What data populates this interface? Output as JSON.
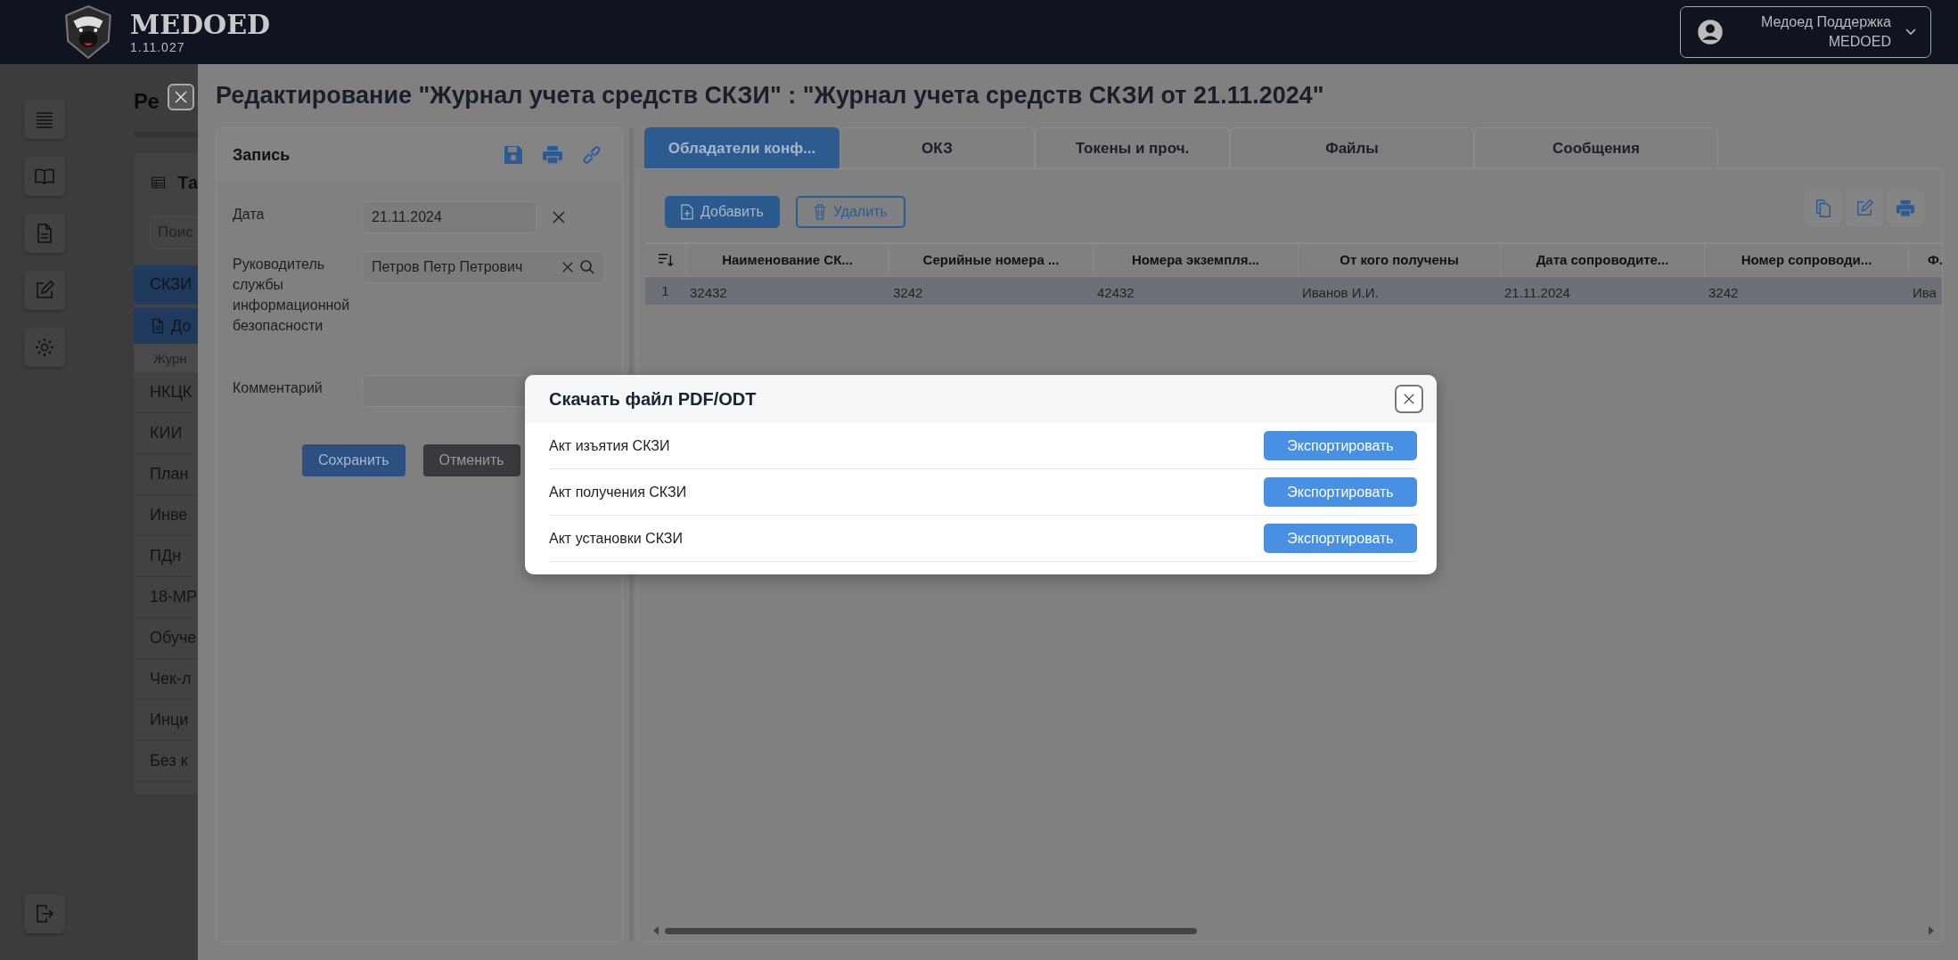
{
  "header": {
    "logo_text": "MEDOED",
    "version": "1.11.027",
    "user": {
      "name": "Медоед Поддержка",
      "org": "MEDOED"
    }
  },
  "background_page": {
    "title": "Ре",
    "card_title": "Та",
    "search": {
      "placeholder": "Поис"
    },
    "menu": [
      {
        "label": "СКЗИ",
        "selected": true,
        "children": [
          {
            "label": "До",
            "selected": true,
            "children": [
              {
                "label": "Журн",
                "selected": false
              }
            ]
          }
        ]
      },
      {
        "label": "НКЦК",
        "selected": false
      },
      {
        "label": "КИИ",
        "selected": false
      },
      {
        "label": "План",
        "selected": false
      },
      {
        "label": "Инве",
        "selected": false
      },
      {
        "label": "ПДн",
        "selected": false
      },
      {
        "label": "18-МР",
        "selected": false
      },
      {
        "label": "Обуче",
        "selected": false
      },
      {
        "label": "Чек-л",
        "selected": false
      },
      {
        "label": "Инци",
        "selected": false
      },
      {
        "label": "Без к",
        "selected": false
      }
    ]
  },
  "drawer": {
    "title": "Редактирование \"Журнал учета средств СКЗИ\" : \"Журнал учета средств СКЗИ от 21.11.2024\"",
    "record": {
      "title": "Запись",
      "fields": [
        {
          "label": "Дата",
          "value": "21.11.2024",
          "kind": "date"
        },
        {
          "label": "Руководитель службы информационной безопасности",
          "value": "Петров Петр Петрович",
          "kind": "lookup"
        },
        {
          "label": "Комментарий",
          "kind": "text"
        }
      ],
      "buttons": [
        {
          "label": "Сохранить",
          "kind": "primary"
        },
        {
          "label": "Отменить",
          "kind": "secondary"
        }
      ]
    },
    "tabs": [
      {
        "label": "Обладатели конф...",
        "selected": true
      },
      {
        "label": "ОКЗ",
        "selected": false
      },
      {
        "label": "Токены и проч.",
        "selected": false
      },
      {
        "label": "Файлы",
        "selected": false
      },
      {
        "label": "Сообщения",
        "selected": false
      }
    ],
    "toolbar": {
      "buttons": [
        {
          "label": "Добавить",
          "kind": "primary"
        },
        {
          "label": "Удалить",
          "kind": "outline"
        }
      ]
    },
    "table": {
      "columns": [
        "Наименование СК...",
        "Серийные номера ...",
        "Номера экземпля...",
        "От кого получены",
        "Дата сопроводите...",
        "Номер сопроводи...",
        "Ф."
      ],
      "rows": [
        {
          "number": "1",
          "selected": true,
          "cells": [
            "32432",
            "3242",
            "42432",
            "Иванов И.И.",
            "21.11.2024",
            "3242",
            "Ива"
          ]
        }
      ]
    }
  },
  "modal": {
    "title": "Скачать файл PDF/ODT",
    "items": [
      {
        "label": "Акт изъятия СКЗИ",
        "button": "Экспортировать"
      },
      {
        "label": "Акт получения СКЗИ",
        "button": "Экспортировать"
      },
      {
        "label": "Акт установки СКЗИ",
        "button": "Экспортировать"
      }
    ]
  }
}
